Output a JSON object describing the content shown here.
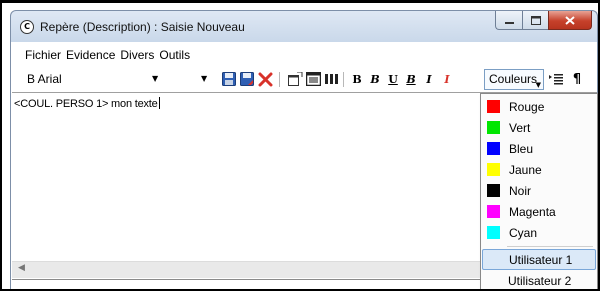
{
  "window": {
    "title": "Repère (Description) : Saisie Nouveau",
    "app_icon_glyph": "C"
  },
  "menu": [
    "Fichier",
    "Evidence",
    "Divers",
    "Outils"
  ],
  "toolbar": {
    "font_name": "B Arial",
    "font_size": "",
    "couleurs_label": "Couleurs",
    "text_buttons": {
      "bold": "B",
      "bold_italic": "B",
      "underline": "U",
      "bold_underline": "B",
      "italic": "I",
      "italic_red": "I"
    },
    "paragraph_glyph": "¶"
  },
  "editor": {
    "content": "<COUL. PERSO 1> mon texte"
  },
  "colors_menu": {
    "items": [
      {
        "label": "Rouge",
        "color": "#ff0000"
      },
      {
        "label": "Vert",
        "color": "#00e600"
      },
      {
        "label": "Bleu",
        "color": "#0000ff"
      },
      {
        "label": "Jaune",
        "color": "#ffff00"
      },
      {
        "label": "Noir",
        "color": "#000000"
      },
      {
        "label": "Magenta",
        "color": "#ff00ff"
      },
      {
        "label": "Cyan",
        "color": "#00ffff"
      }
    ],
    "user_items": [
      {
        "label": "Utilisateur 1",
        "highlighted": true
      },
      {
        "label": "Utilisateur 2",
        "highlighted": false
      }
    ]
  }
}
